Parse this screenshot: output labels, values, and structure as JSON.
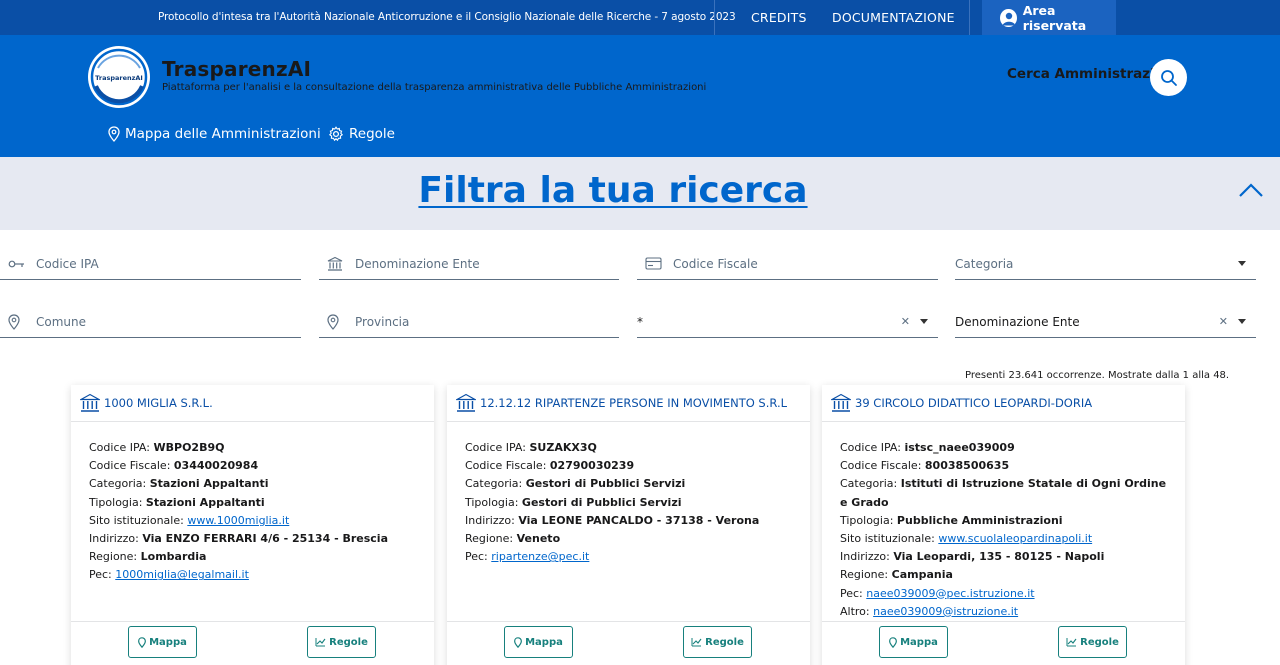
{
  "topbar": {
    "protocol": "Protocollo d'intesa tra l'Autorità Nazionale Anticorruzione e il Consiglio Nazionale delle Ricerche - 7 agosto 2023",
    "credits": "CREDITS",
    "documentazione": "DOCUMENTAZIONE",
    "area_riservata": "Area riservata"
  },
  "header": {
    "logo_text": "TrasparenzAI",
    "title": "TrasparenzAI",
    "subtitle": "Piattaforma per l'analisi e la consultazione della trasparenza amministrativa delle Pubbliche Amministrazioni",
    "cerca": "Cerca Amministrazioni"
  },
  "nav": {
    "mappa": "Mappa delle Amministrazioni",
    "regole": "Regole"
  },
  "filter": {
    "title": "Filtra la tua ricerca",
    "codice_ipa": "Codice IPA",
    "denominazione": "Denominazione Ente",
    "codice_fiscale": "Codice Fiscale",
    "categoria": "Categoria",
    "comune": "Comune",
    "provincia": "Provincia",
    "wildcard": "*",
    "sort": "Denominazione Ente"
  },
  "results_info": "Presenti 23.641 occorrenze. Mostrate dalla 1 alla 48.",
  "labels": {
    "codice_ipa": "Codice IPA:",
    "codice_fiscale": "Codice Fiscale:",
    "categoria": "Categoria:",
    "tipologia": "Tipologia:",
    "sito": "Sito istituzionale:",
    "indirizzo": "Indirizzo:",
    "regione": "Regione:",
    "pec": "Pec:",
    "altro": "Altro:",
    "mappa_btn": "Mappa",
    "regole_btn": "Regole"
  },
  "cards": [
    {
      "name": "1000 MIGLIA S.R.L.",
      "codice_ipa": "WBPO2B9Q",
      "codice_fiscale": "03440020984",
      "categoria": "Stazioni Appaltanti",
      "tipologia": "Stazioni Appaltanti",
      "sito": "www.1000miglia.it",
      "indirizzo": "Via ENZO FERRARI 4/6 - 25134 - Brescia",
      "regione": "Lombardia",
      "pec": "1000miglia@legalmail.it"
    },
    {
      "name": "12.12.12 RIPARTENZE PERSONE IN MOVIMENTO S.R.L",
      "codice_ipa": "SUZAKX3Q",
      "codice_fiscale": "02790030239",
      "categoria": "Gestori di Pubblici Servizi",
      "tipologia": "Gestori di Pubblici Servizi",
      "indirizzo": "Via LEONE PANCALDO - 37138 - Verona",
      "regione": "Veneto",
      "pec": "ripartenze@pec.it"
    },
    {
      "name": "39 CIRCOLO DIDATTICO LEOPARDI-DORIA",
      "codice_ipa": "istsc_naee039009",
      "codice_fiscale": "80038500635",
      "categoria": "Istituti di Istruzione Statale di Ogni Ordine e Grado",
      "tipologia": "Pubbliche Amministrazioni",
      "sito": "www.scuolaleopardinapoli.it",
      "indirizzo": "Via Leopardi, 135 - 80125 - Napoli",
      "regione": "Campania",
      "pec": "naee039009@pec.istruzione.it",
      "altro": "naee039009@istruzione.it"
    }
  ]
}
